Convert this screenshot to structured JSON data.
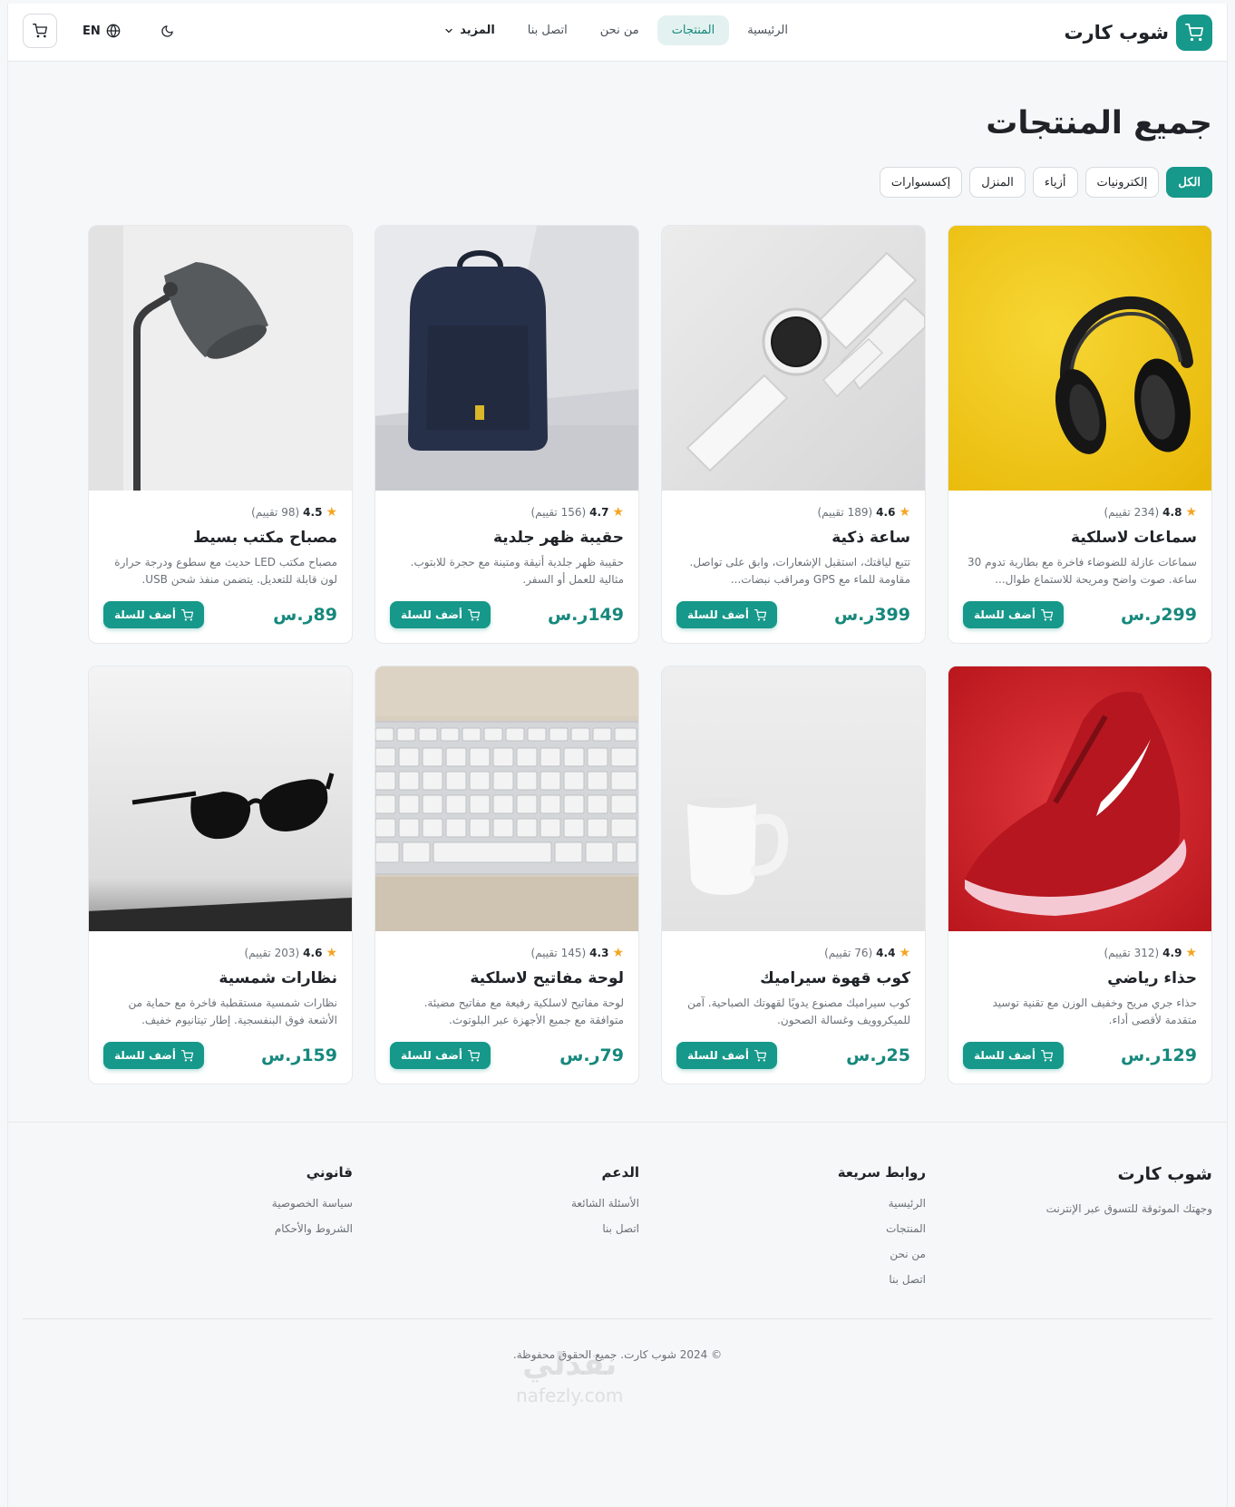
{
  "header": {
    "brand": "شوب كارت",
    "nav": [
      {
        "label": "الرئيسية",
        "active": false
      },
      {
        "label": "المنتجات",
        "active": true
      },
      {
        "label": "من نحن",
        "active": false
      },
      {
        "label": "اتصل بنا",
        "active": false
      },
      {
        "label": "المزيد",
        "active": false
      }
    ],
    "lang": "EN"
  },
  "main": {
    "title": "جميع المنتجات",
    "filters": [
      {
        "label": "الكل",
        "active": true
      },
      {
        "label": "إلكترونيات",
        "active": false
      },
      {
        "label": "أزياء",
        "active": false
      },
      {
        "label": "المنزل",
        "active": false
      },
      {
        "label": "إكسسوارات",
        "active": false
      }
    ],
    "add_to_cart": "أضف للسلة",
    "products": [
      {
        "name": "سماعات لاسلكية",
        "rating": "4.8",
        "reviews": "(234 تقييم)",
        "desc": "سماعات عازلة للضوضاء فاخرة مع بطارية تدوم 30 ساعة. صوت واضح ومريحة للاستماع طوال...",
        "price": "299ر.س",
        "image": "headphones"
      },
      {
        "name": "ساعة ذكية",
        "rating": "4.6",
        "reviews": "(189 تقييم)",
        "desc": "تتبع لياقتك، استقبل الإشعارات، وابق على تواصل. مقاومة للماء مع GPS ومراقب نبضات...",
        "price": "399ر.س",
        "image": "smartwatch"
      },
      {
        "name": "حقيبة ظهر جلدية",
        "rating": "4.7",
        "reviews": "(156 تقييم)",
        "desc": "حقيبة ظهر جلدية أنيقة ومتينة مع حجرة للابتوب. مثالية للعمل أو السفر.",
        "price": "149ر.س",
        "image": "backpack"
      },
      {
        "name": "مصباح مكتب بسيط",
        "rating": "4.5",
        "reviews": "(98 تقييم)",
        "desc": "مصباح مكتب LED حديث مع سطوع ودرجة حرارة لون قابلة للتعديل. يتضمن منفذ شحن USB.",
        "price": "89ر.س",
        "image": "lamp"
      },
      {
        "name": "حذاء رياضي",
        "rating": "4.9",
        "reviews": "(312 تقييم)",
        "desc": "حذاء جري مريح وخفيف الوزن مع تقنية توسيد متقدمة لأقصى أداء.",
        "price": "129ر.س",
        "image": "sneaker"
      },
      {
        "name": "كوب قهوة سيراميك",
        "rating": "4.4",
        "reviews": "(76 تقييم)",
        "desc": "كوب سيراميك مصنوع يدويًا لقهوتك الصباحية. آمن للميكروويف وغسالة الصحون.",
        "price": "25ر.س",
        "image": "mug"
      },
      {
        "name": "لوحة مفاتيح لاسلكية",
        "rating": "4.3",
        "reviews": "(145 تقييم)",
        "desc": "لوحة مفاتيح لاسلكية رفيعة مع مفاتيح مضيئة. متوافقة مع جميع الأجهزة عبر البلوتوث.",
        "price": "79ر.س",
        "image": "keyboard"
      },
      {
        "name": "نظارات شمسية",
        "rating": "4.6",
        "reviews": "(203 تقييم)",
        "desc": "نظارات شمسية مستقطبة فاخرة مع حماية من الأشعة فوق البنفسجية. إطار تيتانيوم خفيف.",
        "price": "159ر.س",
        "image": "sunglasses"
      }
    ]
  },
  "footer": {
    "brand": "شوب كارت",
    "tagline": "وجهتك الموثوقة للتسوق عبر الإنترنت",
    "quick_links": {
      "title": "روابط سريعة",
      "items": [
        "الرئيسية",
        "المنتجات",
        "من نحن",
        "اتصل بنا"
      ]
    },
    "support": {
      "title": "الدعم",
      "items": [
        "الأسئلة الشائعة",
        "اتصل بنا"
      ]
    },
    "legal": {
      "title": "قانوني",
      "items": [
        "سياسة الخصوصية",
        "الشروط والأحكام"
      ]
    },
    "copyright": "© 2024 شوب كارت. جميع الحقوق محفوظة.",
    "watermark": "نفذلي",
    "watermark_url": "nafezly.com"
  },
  "colors": {
    "accent": "#16988a",
    "accent_light": "#e3f2f0",
    "star": "#f5a524"
  }
}
